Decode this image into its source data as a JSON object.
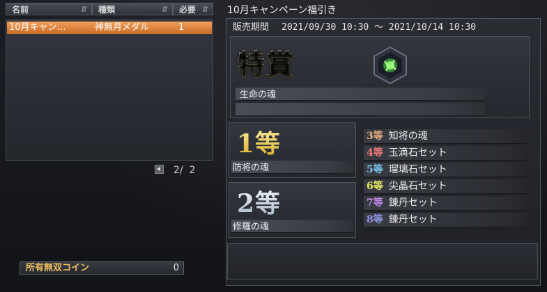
{
  "list": {
    "headers": [
      {
        "label": "名前",
        "sort_icon": "sort-icon"
      },
      {
        "label": "種類",
        "sort_icon": "sort-icon"
      },
      {
        "label": "必要",
        "sort_icon": "sort-icon"
      }
    ],
    "rows": [
      {
        "name": "10月キャン…",
        "type": "神無月メダル",
        "required": "1"
      }
    ],
    "pager": {
      "current": "2",
      "separator": "/",
      "total": "2"
    }
  },
  "coin": {
    "label": "所有無双コイン",
    "value": "0"
  },
  "campaign": {
    "title": "10月キャンペーン福引き",
    "period_label": "販売期間",
    "period_value": "2021/09/30 10:30 ～ 2021/10/14 10:30"
  },
  "special": {
    "rank_label": "特賞",
    "item": "生命の魂",
    "icon": "gem-medal-icon"
  },
  "first": {
    "rank_label": "1等",
    "item": "防将の魂"
  },
  "second": {
    "rank_label": "2等",
    "item": "修羅の魂"
  },
  "ranks": [
    {
      "num": "3",
      "suffix": "等",
      "item": "知将の魂",
      "color": "#e8b080"
    },
    {
      "num": "4",
      "suffix": "等",
      "item": "玉滴石セット",
      "color": "#f07878"
    },
    {
      "num": "5",
      "suffix": "等",
      "item": "瑠璃石セット",
      "color": "#78c8f0"
    },
    {
      "num": "6",
      "suffix": "等",
      "item": "尖晶石セット",
      "color": "#e8e860"
    },
    {
      "num": "7",
      "suffix": "等",
      "item": "錬丹セット",
      "color": "#c088e8"
    },
    {
      "num": "8",
      "suffix": "等",
      "item": "錬丹セット",
      "color": "#9098e8"
    }
  ],
  "colors": {
    "selected_row": "#e08a3c",
    "coin_label": "#f0c060"
  }
}
